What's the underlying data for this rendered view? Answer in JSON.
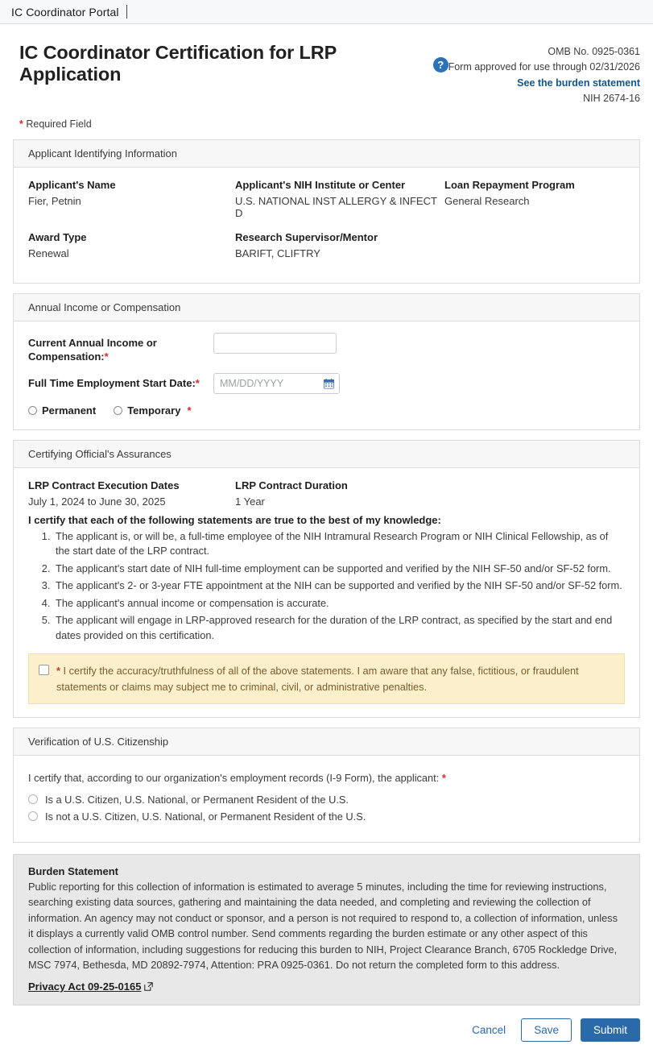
{
  "portal": {
    "title": "IC Coordinator Portal"
  },
  "header": {
    "page_title": "IC Coordinator Certification for LRP Application",
    "help_icon_glyph": "?",
    "omb_number": "OMB No. 0925-0361",
    "form_approved": "Form approved for use through 02/31/2026",
    "burden_link": "See the burden statement",
    "form_id": "NIH 2674-16",
    "required_field_note": "Required Field",
    "required_marker": "*"
  },
  "applicant_section": {
    "heading": "Applicant Identifying Information",
    "fields": [
      {
        "label": "Applicant's Name",
        "value": "Fier, Petnin"
      },
      {
        "label": "Applicant's NIH Institute or Center",
        "value": "U.S. NATIONAL INST ALLERGY & INFECT D"
      },
      {
        "label": "Loan Repayment Program",
        "value": "General Research"
      },
      {
        "label": "Award Type",
        "value": "Renewal"
      },
      {
        "label": "Research Supervisor/Mentor",
        "value": "BARIFT, CLIFTRY"
      },
      {
        "label": "",
        "value": ""
      }
    ]
  },
  "income_section": {
    "heading": "Annual Income or Compensation",
    "income_label": "Current Annual Income or Compensation:",
    "income_value": "",
    "income_placeholder": "",
    "start_date_label": "Full Time Employment Start Date:",
    "start_date_value": "",
    "start_date_placeholder": "MM/DD/YYYY",
    "calendar_icon": "calendar-icon",
    "permanent_label": "Permanent",
    "temporary_label": "Temporary",
    "required_marker": "*"
  },
  "assurances_section": {
    "heading": "Certifying Official's Assurances",
    "contract_dates_label": "LRP Contract Execution Dates",
    "contract_dates_value": "July 1, 2024 to June 30, 2025",
    "contract_duration_label": "LRP Contract Duration",
    "contract_duration_value": "1 Year",
    "certify_lead": "I certify that each of the following statements are true to the best of my knowledge:",
    "statements": [
      "The applicant is, or will be, a full-time employee of the NIH Intramural Research Program or NIH Clinical Fellowship, as of the start date of the LRP contract.",
      "The applicant's start date of NIH full-time employment can be supported and verified by the NIH SF-50 and/or SF-52 form.",
      "The applicant's 2- or 3-year FTE appointment at the NIH can be supported and verified by the NIH SF-50 and/or SF-52 form.",
      "The applicant's annual income or compensation is accurate.",
      "The applicant will engage in LRP-approved research for the duration of the LRP contract, as specified by the start and end dates provided on this certification."
    ],
    "attestation": "I certify the accuracy/truthfulness of all of the above statements. I am aware that any false, fictitious, or fraudulent statements or claims may subject me to criminal, civil, or administrative penalties.",
    "required_marker": "*"
  },
  "citizenship_section": {
    "heading": "Verification of U.S. Citizenship",
    "lead": "I certify that, according to our organization's employment records (I-9 Form), the applicant:",
    "required_marker": "*",
    "options": [
      "Is a U.S. Citizen, U.S. National, or Permanent Resident of the U.S.",
      "Is not a U.S. Citizen, U.S. National, or Permanent Resident of the U.S."
    ]
  },
  "burden_statement": {
    "title": "Burden Statement",
    "text": "Public reporting for this collection of information is estimated to average 5 minutes, including the time for reviewing instructions, searching existing data sources, gathering and maintaining the data needed, and completing and reviewing the collection of information. An agency may not conduct or sponsor, and a person is not required to respond to, a collection of information, unless it displays a currently valid OMB control number. Send comments regarding the burden estimate or any other aspect of this collection of information, including suggestions for reducing this burden to NIH, Project Clearance Branch, 6705 Rockledge Drive, MSC 7974, Bethesda, MD 20892-7974, Attention: PRA 0925-0361. Do not return the completed form to this address.",
    "privacy_link": "Privacy Act 09-25-0165",
    "external_icon": "external-link-icon"
  },
  "footer": {
    "cancel_label": "Cancel",
    "save_label": "Save",
    "submit_label": "Submit"
  },
  "colors": {
    "accent_blue": "#2a6aa8",
    "link_blue": "#13558c",
    "required_red": "#d02b27",
    "warning_bg": "#fbf0cb",
    "warning_text": "#7a5c2e",
    "panel_head_bg": "#f7f7f7",
    "burden_bg": "#e8e8e8"
  }
}
